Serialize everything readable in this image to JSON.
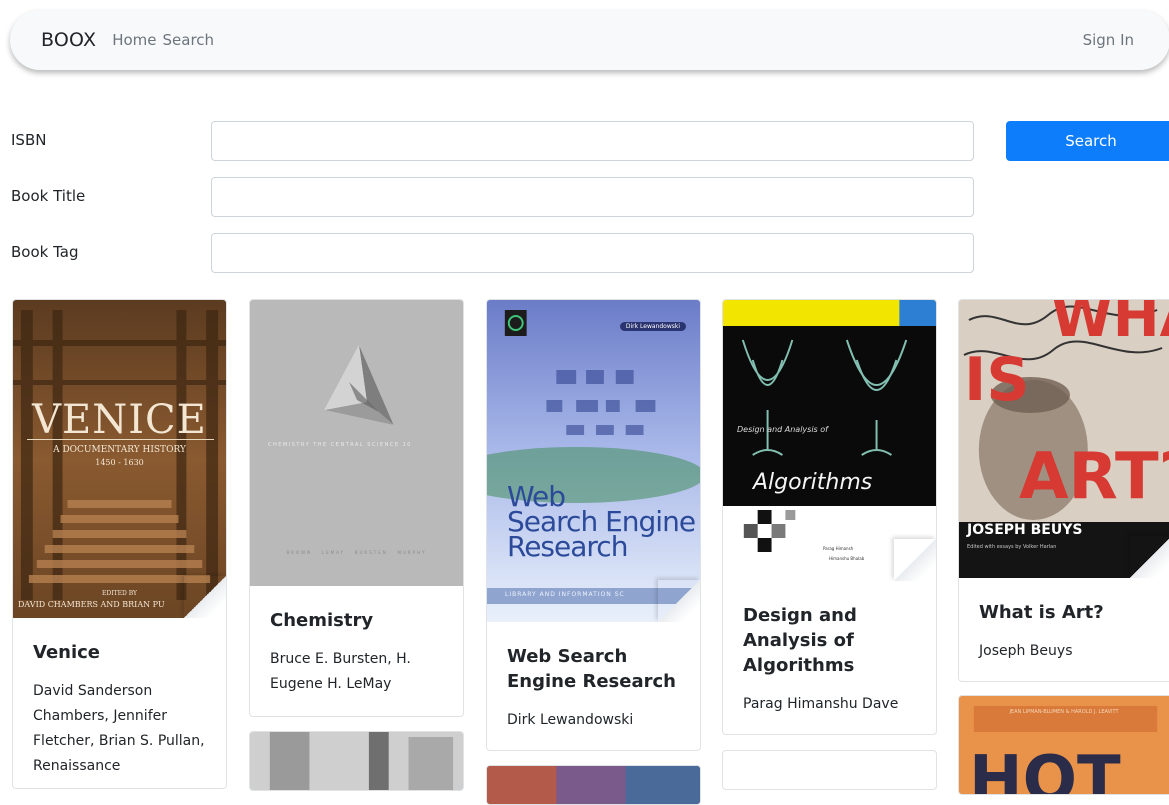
{
  "navbar": {
    "brand": "BOOX",
    "links": [
      "Home",
      "Search"
    ],
    "signin": "Sign In"
  },
  "search_form": {
    "isbn_label": "ISBN",
    "title_label": "Book Title",
    "tag_label": "Book Tag",
    "isbn_value": "",
    "title_value": "",
    "tag_value": "",
    "search_button": "Search"
  },
  "books": [
    {
      "title": "Venice",
      "authors": "David Sanderson Chambers, Jennifer Fletcher, Brian S. Pullan, Renaissance",
      "cover": {
        "main": "VENICE",
        "sub1": "A DOCUMENTARY HISTORY",
        "sub2": "1450 - 1630",
        "editors_prefix": "EDITED BY",
        "editors": "DAVID CHAMBERS AND BRIAN PU"
      }
    },
    {
      "title": "Chemistry",
      "authors": "Bruce E. Bursten, H. Eugene H. LeMay",
      "cover": {
        "main": "CHEMISTRY",
        "sub": "THE CENTRAL SCIENCE 10",
        "authors_line": "BROWN   LEMAY   BURSTEN   MURPHY"
      }
    },
    {
      "title": "Web Search Engine Research",
      "authors": "Dirk Lewandowski",
      "cover": {
        "author_tag": "Dirk Lewandowski",
        "line1": "Web",
        "line2": "Search Engine",
        "line3": "Research",
        "series": "LIBRARY AND INFORMATION SC"
      }
    },
    {
      "title": "Design and Analysis of Algorithms",
      "authors": "Parag Himanshu Dave",
      "cover": {
        "small": "Design and Analysis of",
        "main": "Algorithms",
        "authors_line1": "Parag Himansh",
        "authors_line2": "Himanshu Bhalab"
      }
    },
    {
      "title": "What is Art?",
      "authors": "Joseph Beuys",
      "cover": {
        "big1": "WHAT",
        "big2": "IS",
        "big3": "ART?",
        "author_band": "JOSEPH BEUYS",
        "small": "Edited with essays by Volker Harlan"
      }
    },
    {
      "cover": {
        "authors_band": "JEAN LIPMAN-BLUMEN & HAROLD J. LEAVITT",
        "big": "HOT"
      }
    }
  ],
  "colors": {
    "primary": "#0d7dfb",
    "navbar_bg": "#f8f9fa",
    "nav_link": "#6c757d",
    "border": "#ced4da"
  }
}
